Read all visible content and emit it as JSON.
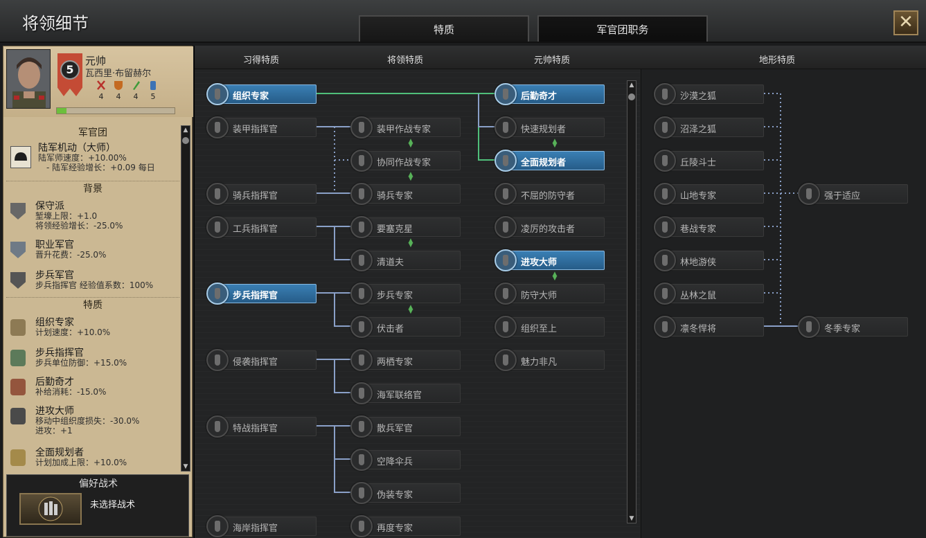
{
  "window": {
    "title": "将领细节",
    "close_label": "✕"
  },
  "tabs": [
    {
      "label": "特质"
    },
    {
      "label": "军官团职务"
    }
  ],
  "general": {
    "rank": "元帅",
    "name": "瓦西里·布留赫尔",
    "level": "5",
    "stats": {
      "attack": "4",
      "defense": "4",
      "planning": "4",
      "logistics": "5"
    },
    "xp_fraction": 0.08
  },
  "officer_corps": {
    "section_title": "军官团",
    "role_name": "陆军机动（大师）",
    "role_effect_1": "陆军师速度：+10.00%",
    "role_effect_2": "- 陆军经验增长：+0.09 每日"
  },
  "background": {
    "section_title": "背景",
    "items": [
      {
        "name": "保守派",
        "l1": "堑壕上限：+1.0",
        "l2": "将领经验增长：-25.0%"
      },
      {
        "name": "职业军官",
        "l1": "晋升花费：-25.0%"
      },
      {
        "name": "步兵军官",
        "l1": "步兵指挥官 经验值系数：100%"
      }
    ]
  },
  "traits_panel": {
    "section_title": "特质",
    "items": [
      {
        "name": "组织专家",
        "l1": "计划速度：+10.0%"
      },
      {
        "name": "步兵指挥官",
        "l1": "步兵单位防御：+15.0%"
      },
      {
        "name": "后勤奇才",
        "l1": "补给消耗：-15.0%"
      },
      {
        "name": "进攻大师",
        "l1": "移动中组织度损失：-30.0%",
        "l2": "进攻：+1"
      },
      {
        "name": "全面规划者",
        "l1": "计划加成上限：+10.0%"
      }
    ]
  },
  "tactics": {
    "title": "偏好战术",
    "value": "未选择战术"
  },
  "columns": [
    "习得特质",
    "将领特质",
    "元帅特质",
    "地形特质"
  ],
  "tree": {
    "col1": [
      {
        "name": "组织专家",
        "active": true
      },
      {
        "name": "装甲指挥官",
        "active": false
      },
      {
        "name": "骑兵指挥官",
        "active": false
      },
      {
        "name": "工兵指挥官",
        "active": false
      },
      {
        "name": "步兵指挥官",
        "active": true
      },
      {
        "name": "侵袭指挥官",
        "active": false
      },
      {
        "name": "特战指挥官",
        "active": false
      },
      {
        "name": "海岸指挥官",
        "active": false
      }
    ],
    "col2": [
      {
        "name": "装甲作战专家"
      },
      {
        "name": "协同作战专家"
      },
      {
        "name": "骑兵专家"
      },
      {
        "name": "要塞克星"
      },
      {
        "name": "清道夫"
      },
      {
        "name": "步兵专家"
      },
      {
        "name": "伏击者"
      },
      {
        "name": "两栖专家"
      },
      {
        "name": "海军联络官"
      },
      {
        "name": "散兵军官"
      },
      {
        "name": "空降伞兵"
      },
      {
        "name": "伪装专家"
      },
      {
        "name": "再度专家"
      }
    ],
    "col3": [
      {
        "name": "后勤奇才",
        "active": true
      },
      {
        "name": "快速规划者",
        "active": false
      },
      {
        "name": "全面规划者",
        "active": true
      },
      {
        "name": "不屈的防守者",
        "active": false
      },
      {
        "name": "凌厉的攻击者",
        "active": false
      },
      {
        "name": "进攻大师",
        "active": true
      },
      {
        "name": "防守大师",
        "active": false
      },
      {
        "name": "组织至上",
        "active": false
      },
      {
        "name": "魅力非凡",
        "active": false
      }
    ],
    "terrain": [
      {
        "name": "沙漠之狐"
      },
      {
        "name": "沼泽之狐"
      },
      {
        "name": "丘陵斗士"
      },
      {
        "name": "山地专家"
      },
      {
        "name": "巷战专家"
      },
      {
        "name": "林地游侠"
      },
      {
        "name": "丛林之鼠"
      },
      {
        "name": "凛冬悍将"
      }
    ],
    "terrain2": [
      {
        "name": "强于适应"
      },
      {
        "name": "冬季专家"
      }
    ]
  },
  "colors": {
    "active": "#2f6f9f",
    "link_active": "#4fbf7a",
    "link_inactive": "#8aa0c8",
    "xp": "#6cbf3c"
  }
}
